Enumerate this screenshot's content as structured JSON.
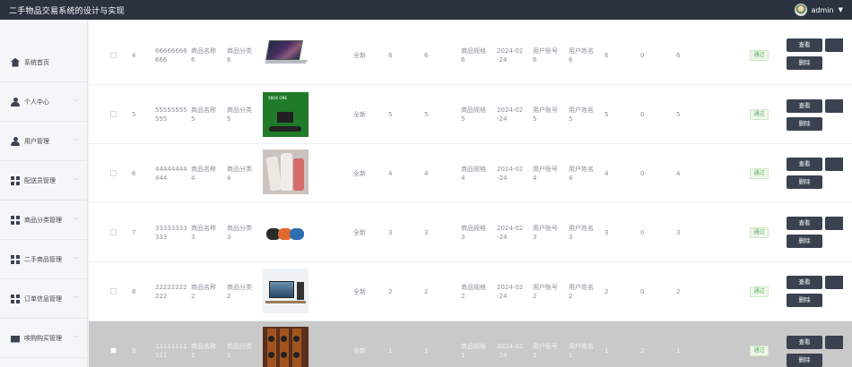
{
  "app": {
    "title": "二手物品交易系统的设计与实现",
    "user": "admin"
  },
  "sidebar": {
    "items": [
      {
        "label": "系统首页",
        "icon": "home-icon"
      },
      {
        "label": "个人中心",
        "icon": "user-icon"
      },
      {
        "label": "用户管理",
        "icon": "user-icon"
      },
      {
        "label": "配送员管理",
        "icon": "grid-icon"
      },
      {
        "label": "商品分类管理",
        "icon": "grid-icon"
      },
      {
        "label": "二手商品管理",
        "icon": "grid-icon"
      },
      {
        "label": "订单信息管理",
        "icon": "grid-icon"
      },
      {
        "label": "咳购购买管理",
        "icon": "bag-icon"
      }
    ]
  },
  "table": {
    "rows": [
      {
        "idx": "4",
        "code": [
          "66666666",
          "666"
        ],
        "name": [
          "商品名称",
          "6"
        ],
        "category": [
          "商品分类",
          "6"
        ],
        "thumb": "laptop",
        "condition": "全新",
        "c1": "6",
        "c2": "6",
        "spec": [
          "商品规格",
          "6"
        ],
        "date": [
          "2024-02",
          "-24"
        ],
        "account": [
          "用户账号",
          "6"
        ],
        "username": [
          "用户姓名",
          "6"
        ],
        "n1": "6",
        "n2": "0",
        "n3": "6",
        "status": "通过",
        "view": "查看",
        "del": "删除"
      },
      {
        "idx": "5",
        "code": [
          "55555555",
          "555"
        ],
        "name": [
          "商品名称",
          "5"
        ],
        "category": [
          "商品分类",
          "5"
        ],
        "thumb": "xbox",
        "thumb_text": "XBOX ONE",
        "condition": "全新",
        "c1": "5",
        "c2": "5",
        "spec": [
          "商品规格",
          "5"
        ],
        "date": [
          "2024-02",
          "-24"
        ],
        "account": [
          "用户账号",
          "5"
        ],
        "username": [
          "用户姓名",
          "5"
        ],
        "n1": "5",
        "n2": "0",
        "n3": "5",
        "status": "通过",
        "view": "查看",
        "del": "删除"
      },
      {
        "idx": "6",
        "code": [
          "44444444",
          "444"
        ],
        "name": [
          "商品名称",
          "4"
        ],
        "category": [
          "商品分类",
          "4"
        ],
        "thumb": "tubes",
        "condition": "全新",
        "c1": "4",
        "c2": "4",
        "spec": [
          "商品规格",
          "4"
        ],
        "date": [
          "2024-02",
          "-24"
        ],
        "account": [
          "用户账号",
          "4"
        ],
        "username": [
          "用户姓名",
          "4"
        ],
        "n1": "4",
        "n2": "0",
        "n3": "4",
        "status": "通过",
        "view": "查看",
        "del": "删除"
      },
      {
        "idx": "7",
        "code": [
          "33333333",
          "333"
        ],
        "name": [
          "商品名称",
          "3"
        ],
        "category": [
          "商品分类",
          "3"
        ],
        "thumb": "speakers",
        "condition": "全新",
        "c1": "3",
        "c2": "3",
        "spec": [
          "商品规格",
          "3"
        ],
        "date": [
          "2024-02",
          "-24"
        ],
        "account": [
          "用户账号",
          "3"
        ],
        "username": [
          "用户姓名",
          "3"
        ],
        "n1": "3",
        "n2": "0",
        "n3": "3",
        "status": "通过",
        "view": "查看",
        "del": "删除"
      },
      {
        "idx": "8",
        "code": [
          "22222222",
          "222"
        ],
        "name": [
          "商品名称",
          "2"
        ],
        "category": [
          "商品分类",
          "2"
        ],
        "thumb": "monitor",
        "condition": "全新",
        "c1": "2",
        "c2": "2",
        "spec": [
          "商品规格",
          "2"
        ],
        "date": [
          "2024-02",
          "-24"
        ],
        "account": [
          "用户账号",
          "2"
        ],
        "username": [
          "用户姓名",
          "2"
        ],
        "n1": "2",
        "n2": "0",
        "n3": "2",
        "status": "通过",
        "view": "查看",
        "del": "删除"
      },
      {
        "idx": "9",
        "code": [
          "11111111",
          "111"
        ],
        "name": [
          "商品名称",
          "1"
        ],
        "category": [
          "商品分类",
          "1"
        ],
        "thumb": "speakers2",
        "condition": "全新",
        "c1": "1",
        "c2": "1",
        "spec": [
          "商品规格",
          "1"
        ],
        "date": [
          "2024-02",
          "-24"
        ],
        "account": [
          "用户账号",
          "1"
        ],
        "username": [
          "用户姓名",
          "1"
        ],
        "n1": "1",
        "n2": "2",
        "n3": "1",
        "status": "通过",
        "view": "查看",
        "del": "删除",
        "selected": true
      }
    ]
  },
  "colors": {
    "topbar": "#2c3340",
    "button": "#3a4250",
    "status_bg": "#edf7ea",
    "status_text": "#5aa65a"
  }
}
